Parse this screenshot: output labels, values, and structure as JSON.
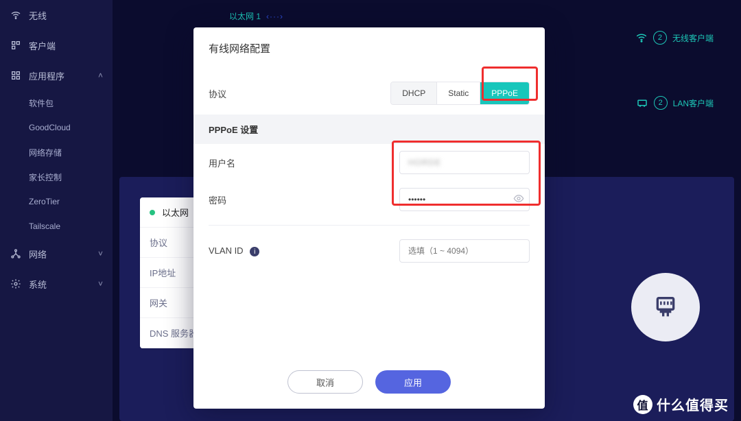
{
  "sidebar": {
    "wireless": "无线",
    "clients": "客户端",
    "apps": "应用程序",
    "apps_children": [
      "软件包",
      "GoodCloud",
      "网络存储",
      "家长控制",
      "ZeroTier",
      "Tailscale"
    ],
    "network": "网络",
    "system": "系统"
  },
  "topology": {
    "eth_port": "以太网 1",
    "eth_arrows": "‹···›",
    "wifi_clients_label": "无线客户端",
    "wifi_clients_count": "2",
    "lan_clients_label": "LAN客户端",
    "lan_clients_count": "2"
  },
  "panel": {
    "tab_active": "以太网",
    "rows": [
      "协议",
      "IP地址",
      "网关",
      "DNS 服务器"
    ]
  },
  "modal": {
    "title": "有线网络配置",
    "protocol_label": "协议",
    "protocol_options": {
      "dhcp": "DHCP",
      "static": "Static",
      "pppoe": "PPPoE"
    },
    "section_pppoe": "PPPoE 设置",
    "username_label": "用户名",
    "username_value": "HORDE",
    "password_label": "密码",
    "password_value": "••••••",
    "vlan_label": "VLAN ID",
    "vlan_placeholder": "选填（1 ~ 4094）",
    "cancel": "取消",
    "apply": "应用"
  },
  "watermark": "什么值得买",
  "watermark_badge": "值"
}
